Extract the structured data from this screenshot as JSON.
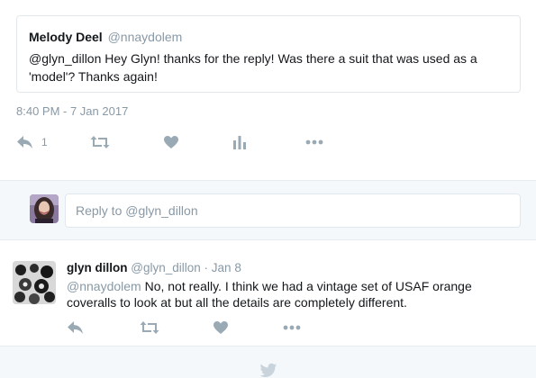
{
  "quoted_tweet": {
    "author_name": "Melody Deel",
    "author_handle": "@nnaydolem",
    "text": "@glyn_dillon Hey Glyn! thanks for the reply! Was there a suit that was used as a 'model'?  Thanks again!"
  },
  "timestamp": "8:40 PM - 7 Jan 2017",
  "tweet_actions": {
    "reply_count": "1",
    "icons": [
      "reply-icon",
      "retweet-icon",
      "like-icon",
      "analytics-icon",
      "more-icon"
    ]
  },
  "reply_composer": {
    "placeholder": "Reply to @glyn_dillon"
  },
  "reply_tweet": {
    "author_name": "glyn dillon",
    "author_handle": "@glyn_dillon",
    "separator": "·",
    "date": "Jan 8",
    "mention": "@nnaydolem",
    "text": " No, not really. I think we had a vintage set of USAF orange coveralls to look at but all the details are completely different."
  },
  "colors": {
    "text": "#14171a",
    "muted": "#8899a6",
    "icon": "#9aaab5",
    "border": "#e1e8ed",
    "band": "#f5f8fa"
  }
}
